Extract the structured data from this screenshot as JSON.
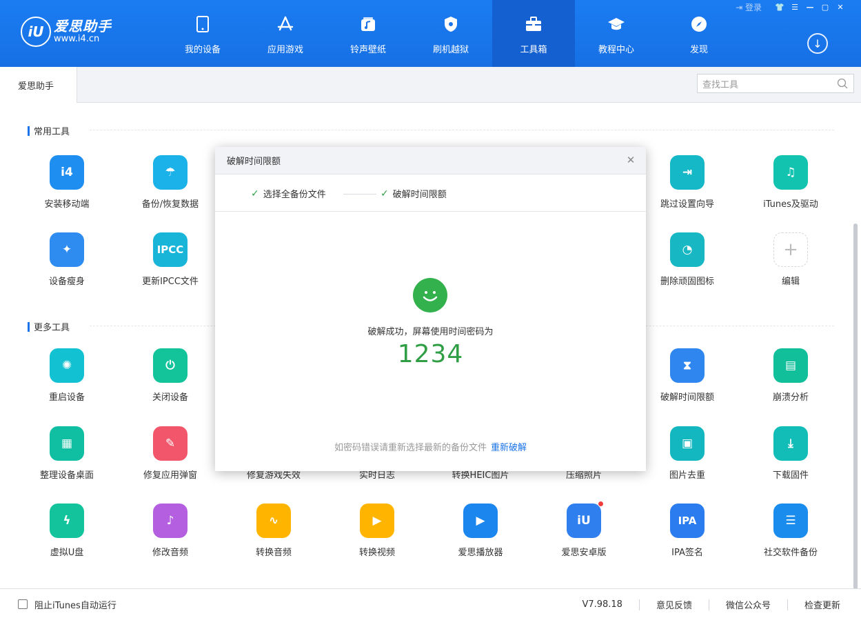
{
  "header": {
    "logo_name": "爱思助手",
    "logo_url": "www.i4.cn",
    "login": "登录",
    "nav": [
      {
        "label": "我的设备",
        "icon": "phone-icon"
      },
      {
        "label": "应用游戏",
        "icon": "app-store-icon"
      },
      {
        "label": "铃声壁纸",
        "icon": "music-icon"
      },
      {
        "label": "刷机越狱",
        "icon": "shield-icon"
      },
      {
        "label": "工具箱",
        "icon": "toolbox-icon",
        "active": true
      },
      {
        "label": "教程中心",
        "icon": "graduation-cap-icon"
      },
      {
        "label": "发现",
        "icon": "compass-icon"
      }
    ]
  },
  "tabbar": {
    "tab": "爱思助手",
    "search_placeholder": "查找工具"
  },
  "sections": {
    "common": "常用工具",
    "more": "更多工具"
  },
  "common_tools": [
    {
      "label": "安装移动端",
      "color": "#1f8ef1",
      "glyph": "i4"
    },
    {
      "label": "备份/恢复数据",
      "color": "#1ab2e8",
      "glyph": "☂"
    },
    {
      "label": "跳过设置向导",
      "color": "#14b8c6",
      "glyph": "⇥"
    },
    {
      "label": "iTunes及驱动",
      "color": "#12c4b0",
      "glyph": "♫"
    },
    {
      "label": "设备瘦身",
      "color": "#2e8cf0",
      "glyph": "✦"
    },
    {
      "label": "更新IPCC文件",
      "color": "#19b5d9",
      "glyph": "IPCC"
    },
    {
      "label": "删除顽固图标",
      "color": "#17b7c4",
      "glyph": "◔"
    },
    {
      "label": "编辑",
      "color": "#ffffff",
      "glyph": "+"
    }
  ],
  "more_tools": [
    {
      "label": "重启设备",
      "color": "#12c1d2",
      "glyph": "✺"
    },
    {
      "label": "关闭设备",
      "color": "#13c39a",
      "glyph": "⏻"
    },
    {
      "label": "破解时间限额",
      "color": "#2f86ef",
      "glyph": "⧗"
    },
    {
      "label": "崩溃分析",
      "color": "#11c09a",
      "glyph": "▤"
    },
    {
      "label": "整理设备桌面",
      "color": "#10bfa2",
      "glyph": "▦"
    },
    {
      "label": "修复应用弹窗",
      "color": "#f2566b",
      "glyph": "✎"
    },
    {
      "label": "修复游戏失效",
      "color": "#ffffff",
      "glyph": ""
    },
    {
      "label": "实时日志",
      "color": "#ffffff",
      "glyph": ""
    },
    {
      "label": "转换HEIC图片",
      "color": "#ffffff",
      "glyph": ""
    },
    {
      "label": "压缩照片",
      "color": "#ffffff",
      "glyph": ""
    },
    {
      "label": "图片去重",
      "color": "#13b7bf",
      "glyph": "▣"
    },
    {
      "label": "下载固件",
      "color": "#12bdb7",
      "glyph": "⤓"
    },
    {
      "label": "虚拟U盘",
      "color": "#12c39b",
      "glyph": "ϟ"
    },
    {
      "label": "修改音频",
      "color": "#b35fe0",
      "glyph": "♪"
    },
    {
      "label": "转换音频",
      "color": "#ffb400",
      "glyph": "∿"
    },
    {
      "label": "转换视频",
      "color": "#ffb400",
      "glyph": "▶"
    },
    {
      "label": "爱思播放器",
      "color": "#1b86ee",
      "glyph": "▶"
    },
    {
      "label": "爱思安卓版",
      "color": "#2f7fef",
      "glyph": "iU"
    },
    {
      "label": "IPA签名",
      "color": "#2b7cee",
      "glyph": "IPA"
    },
    {
      "label": "社交软件备份",
      "color": "#1a8cee",
      "glyph": "☰"
    }
  ],
  "footer": {
    "block_itunes": "阻止iTunes自动运行",
    "version": "V7.98.18",
    "feedback": "意见反馈",
    "wechat": "微信公众号",
    "check_update": "检查更新"
  },
  "dialog": {
    "title": "破解时间限额",
    "step1": "选择全备份文件",
    "step2": "破解时间限额",
    "message": "破解成功，屏幕使用时间密码为",
    "code": "1234",
    "hint": "如密码错误请重新选择最新的备份文件",
    "relink": "重新破解"
  }
}
